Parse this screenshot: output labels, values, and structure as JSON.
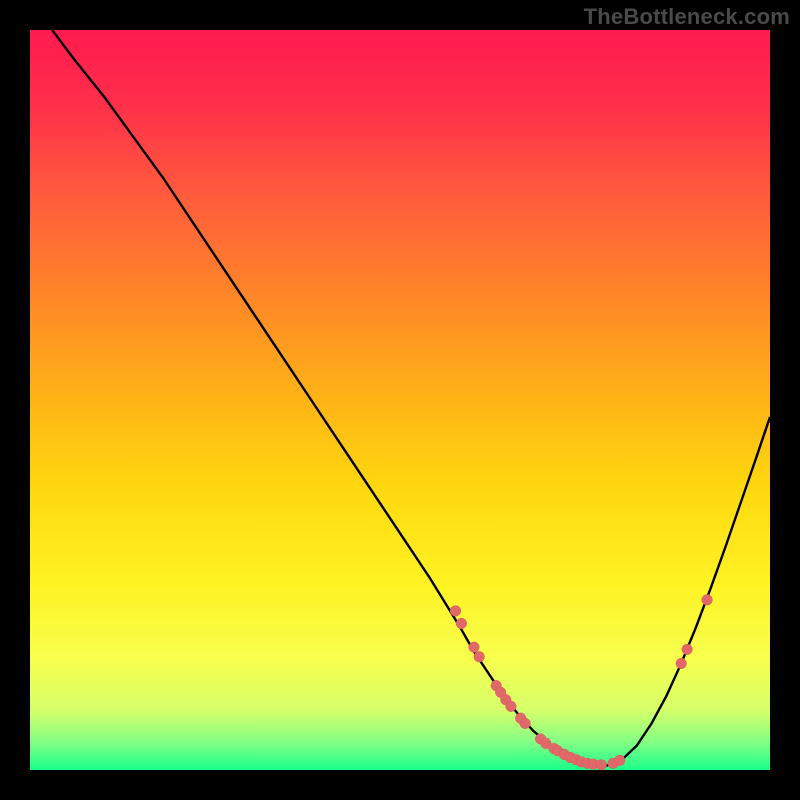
{
  "watermark": "TheBottleneck.com",
  "colors": {
    "background": "#000000",
    "curve": "#000000",
    "dot_fill": "#e06868",
    "dot_stroke": "#d85a5a",
    "gradient_stops": [
      {
        "offset": 0.0,
        "color": "#ff1a4f"
      },
      {
        "offset": 0.1,
        "color": "#ff2f4a"
      },
      {
        "offset": 0.22,
        "color": "#ff5a3d"
      },
      {
        "offset": 0.35,
        "color": "#ff8329"
      },
      {
        "offset": 0.5,
        "color": "#ffb416"
      },
      {
        "offset": 0.62,
        "color": "#ffd80f"
      },
      {
        "offset": 0.75,
        "color": "#fff324"
      },
      {
        "offset": 0.85,
        "color": "#f7ff4d"
      },
      {
        "offset": 0.92,
        "color": "#d4ff6a"
      },
      {
        "offset": 0.965,
        "color": "#7dff85"
      },
      {
        "offset": 1.0,
        "color": "#18ff8a"
      }
    ]
  },
  "chart_data": {
    "type": "line",
    "title": "",
    "xlabel": "",
    "ylabel": "",
    "xlim": [
      0,
      100
    ],
    "ylim": [
      0,
      100
    ],
    "grid": false,
    "series": [
      {
        "name": "curve",
        "x": [
          3,
          6,
          10,
          14,
          18,
          22,
          26,
          30,
          34,
          38,
          42,
          46,
          50,
          54,
          58,
          60,
          62,
          64,
          66,
          68,
          70,
          72,
          74,
          76,
          78,
          80,
          82,
          84,
          86,
          88,
          90,
          92,
          94,
          96,
          98,
          100
        ],
        "y": [
          100,
          96,
          91,
          85.5,
          80,
          74,
          68,
          62,
          56,
          50,
          44,
          38,
          32,
          26,
          19.5,
          16,
          13,
          10,
          7.5,
          5.3,
          3.6,
          2.4,
          1.4,
          0.8,
          0.6,
          1.4,
          3.3,
          6.3,
          10,
          14.4,
          19.3,
          24.6,
          30.2,
          36,
          41.8,
          47.7
        ]
      }
    ],
    "dots": [
      {
        "x": 57.5,
        "y": 21.5
      },
      {
        "x": 58.3,
        "y": 19.8
      },
      {
        "x": 60.0,
        "y": 16.6
      },
      {
        "x": 60.7,
        "y": 15.3
      },
      {
        "x": 63.0,
        "y": 11.4
      },
      {
        "x": 63.6,
        "y": 10.5
      },
      {
        "x": 64.3,
        "y": 9.5
      },
      {
        "x": 65.0,
        "y": 8.6
      },
      {
        "x": 66.3,
        "y": 7.0
      },
      {
        "x": 66.9,
        "y": 6.3
      },
      {
        "x": 69.0,
        "y": 4.2
      },
      {
        "x": 69.7,
        "y": 3.6
      },
      {
        "x": 70.8,
        "y": 2.9
      },
      {
        "x": 71.3,
        "y": 2.6
      },
      {
        "x": 72.2,
        "y": 2.1
      },
      {
        "x": 73.0,
        "y": 1.7
      },
      {
        "x": 73.8,
        "y": 1.4
      },
      {
        "x": 74.5,
        "y": 1.1
      },
      {
        "x": 75.3,
        "y": 0.9
      },
      {
        "x": 76.1,
        "y": 0.8
      },
      {
        "x": 77.2,
        "y": 0.7
      },
      {
        "x": 78.8,
        "y": 0.9
      },
      {
        "x": 79.7,
        "y": 1.3
      },
      {
        "x": 88.0,
        "y": 14.4
      },
      {
        "x": 88.8,
        "y": 16.3
      },
      {
        "x": 91.5,
        "y": 23.0
      }
    ]
  }
}
